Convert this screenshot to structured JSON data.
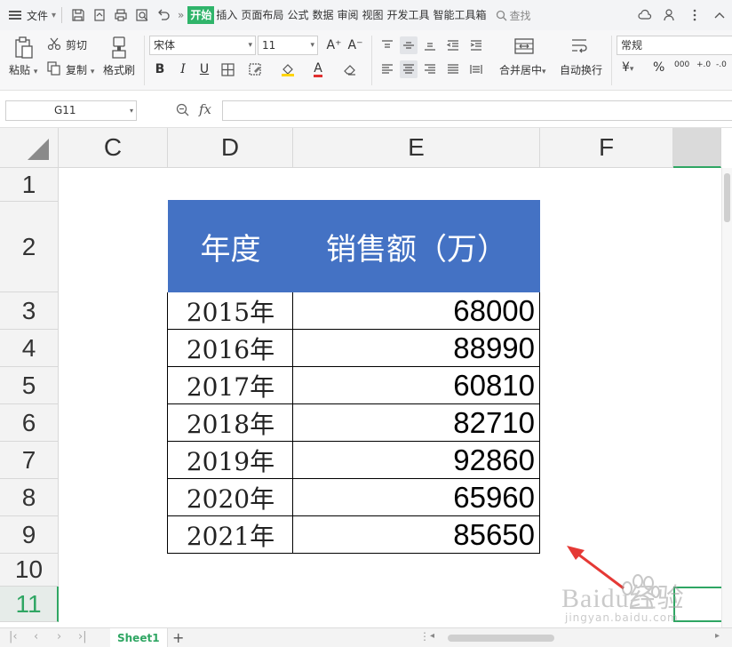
{
  "menubar": {
    "file_label": "文件",
    "tabs": [
      "开始",
      "插入",
      "页面布局",
      "公式",
      "数据",
      "审阅",
      "视图",
      "开发工具",
      "智能工具箱"
    ],
    "search_label": "查找",
    "more": "»"
  },
  "ribbon": {
    "paste": "粘贴",
    "cut": "剪切",
    "copy": "复制",
    "format_painter": "格式刷",
    "font_name": "宋体",
    "font_size": "11",
    "bold": "B",
    "italic": "I",
    "underline": "U",
    "grow_font": "A⁺",
    "shrink_font": "A⁻",
    "font_color_glyph": "A",
    "merge_center": "合并居中",
    "wrap_text": "自动换行",
    "number_format": "常规",
    "currency": "¥",
    "percent": "%",
    "thousands": "000",
    "dec_inc": "+.0",
    "dec_dec": "-.0"
  },
  "formula_bar": {
    "name_box": "G11",
    "fx": "fx",
    "content": ""
  },
  "sheet": {
    "columns": [
      "C",
      "D",
      "E",
      "F"
    ],
    "rows": [
      "1",
      "2",
      "3",
      "4",
      "5",
      "6",
      "7",
      "8",
      "9",
      "10",
      "11"
    ],
    "active_row": "11",
    "table": {
      "headers": [
        "年度",
        "销售额（万）"
      ],
      "rows": [
        {
          "year": "2015年",
          "value": "68000"
        },
        {
          "year": "2016年",
          "value": "88990"
        },
        {
          "year": "2017年",
          "value": "60810"
        },
        {
          "year": "2018年",
          "value": "82710"
        },
        {
          "year": "2019年",
          "value": "92860"
        },
        {
          "year": "2020年",
          "value": "65960"
        },
        {
          "year": "2021年",
          "value": "85650"
        }
      ]
    }
  },
  "tabbar": {
    "sheet_name": "Sheet1",
    "add": "+"
  },
  "watermark": {
    "brand": "Baidu经验",
    "url": "jingyan.baidu.com"
  },
  "colors": {
    "accent_green": "#2fa663",
    "table_header_blue": "#4472c4",
    "annotation_arrow": "#e53935"
  }
}
